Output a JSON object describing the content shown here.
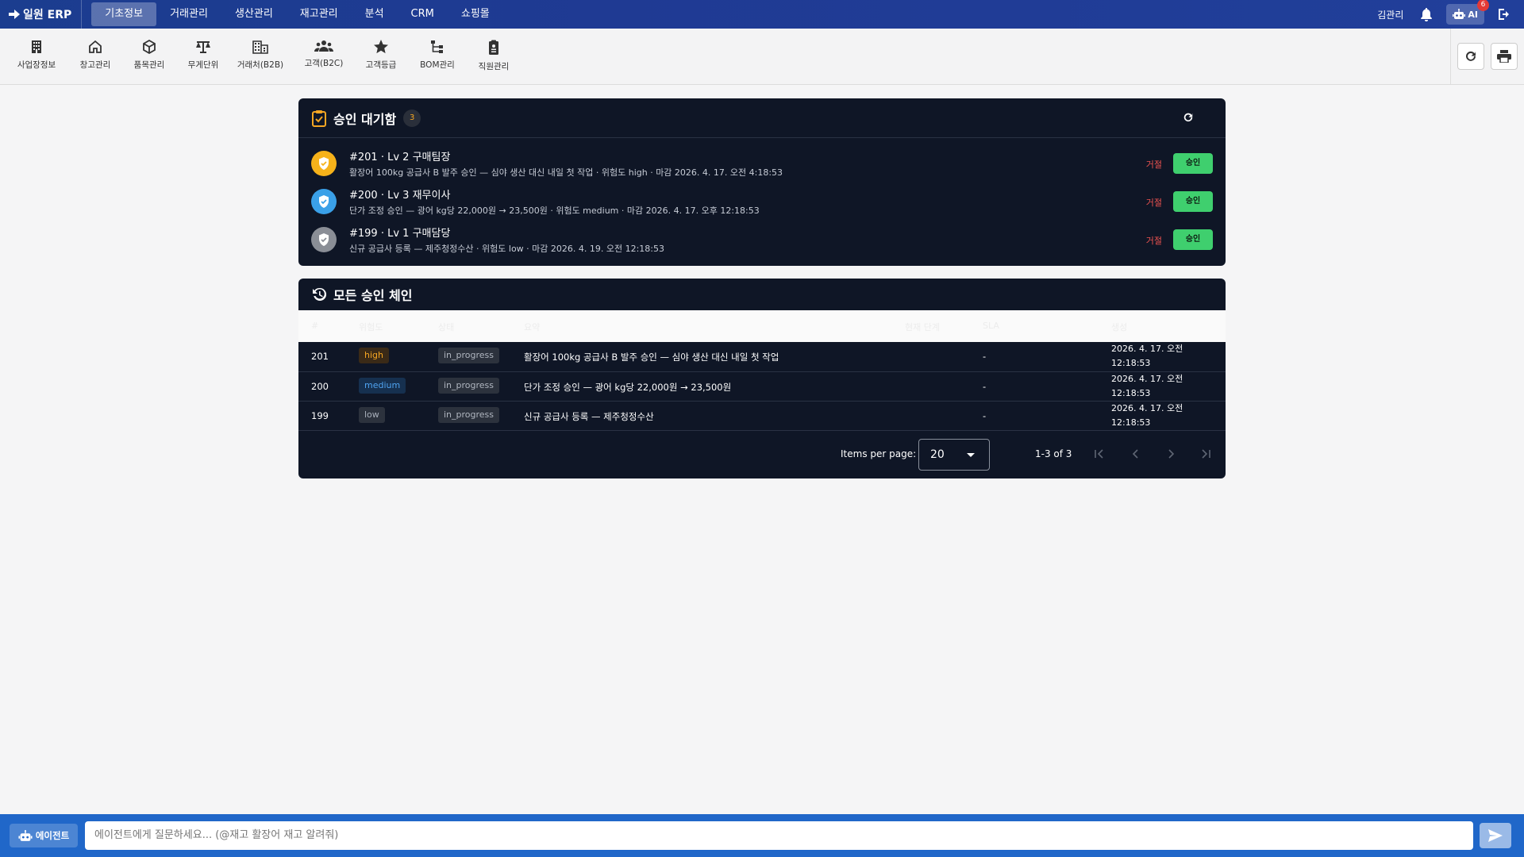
{
  "app": {
    "brand": "일원 ERP"
  },
  "nav": {
    "items": [
      "기초정보",
      "거래관리",
      "생산관리",
      "재고관리",
      "분석",
      "CRM",
      "쇼핑몰"
    ],
    "active": "기초정보"
  },
  "header": {
    "user": "김관리",
    "ai_label": "AI",
    "ai_badge": "6"
  },
  "toolbar": {
    "items": [
      {
        "label": "사업장정보",
        "icon": "building-icon"
      },
      {
        "label": "창고관리",
        "icon": "warehouse-icon"
      },
      {
        "label": "품목관리",
        "icon": "cube-icon"
      },
      {
        "label": "무게단위",
        "icon": "scale-icon"
      },
      {
        "label": "거래처(B2B)",
        "icon": "office-icon"
      },
      {
        "label": "고객(B2C)",
        "icon": "people-icon"
      },
      {
        "label": "고객등급",
        "icon": "star-icon"
      },
      {
        "label": "BOM관리",
        "icon": "tree-icon"
      },
      {
        "label": "직원관리",
        "icon": "badge-icon"
      }
    ]
  },
  "pending": {
    "title": "승인 대기함",
    "count": "3",
    "items": [
      {
        "title": "#201 · Lv 2 구매팀장",
        "desc": "활장어 100kg 공급사 B 발주 승인 — 심야 생산 대신 내일 첫 작업 · 위험도 high · 마감 2026. 4. 17. 오전 4:18:53",
        "reject": "거절",
        "approve": "승인",
        "color": "#f6b21a"
      },
      {
        "title": "#200 · Lv 3 재무이사",
        "desc": "단가 조정 승인 — 광어 kg당 22,000원 → 23,500원 · 위험도 medium · 마감 2026. 4. 17. 오후 12:18:53",
        "reject": "거절",
        "approve": "승인",
        "color": "#3aa0e8"
      },
      {
        "title": "#199 · Lv 1 구매담당",
        "desc": "신규 공급사 등록 — 제주청정수산 · 위험도 low · 마감 2026. 4. 19. 오전 12:18:53",
        "reject": "거절",
        "approve": "승인",
        "color": "#8a8e96"
      }
    ]
  },
  "chains": {
    "title": "모든 승인 체인",
    "columns": [
      "#",
      "위험도",
      "상태",
      "요약",
      "현재 단계",
      "SLA",
      "생성"
    ],
    "rows": [
      {
        "id": "201",
        "risk": "high",
        "status": "in_progress",
        "summary": "활장어 100kg 공급사 B 발주 승인 — 심야 생산 대신 내일 첫 작업",
        "stage": "",
        "sla": "-",
        "created_1": "2026. 4. 17. 오전",
        "created_2": "12:18:53"
      },
      {
        "id": "200",
        "risk": "medium",
        "status": "in_progress",
        "summary": "단가 조정 승인 — 광어 kg당 22,000원 → 23,500원",
        "stage": "",
        "sla": "-",
        "created_1": "2026. 4. 17. 오전",
        "created_2": "12:18:53"
      },
      {
        "id": "199",
        "risk": "low",
        "status": "in_progress",
        "summary": "신규 공급사 등록 — 제주청정수산",
        "stage": "",
        "sla": "-",
        "created_1": "2026. 4. 17. 오전",
        "created_2": "12:18:53"
      }
    ],
    "risk_colors": {
      "high": {
        "bg": "#3a2a17",
        "fg": "#f5a623"
      },
      "medium": {
        "bg": "#16304f",
        "fg": "#4fa3f0"
      },
      "low": {
        "bg": "#2c323d",
        "fg": "#a9b0bb"
      }
    },
    "pager": {
      "items_per_page_label": "Items per page:",
      "items_per_page": "20",
      "range": "1-3 of 3"
    }
  },
  "agent": {
    "button": "에이전트",
    "placeholder": "에이전트에게 질문하세요... (@재고 활장어 재고 알려줘)"
  }
}
